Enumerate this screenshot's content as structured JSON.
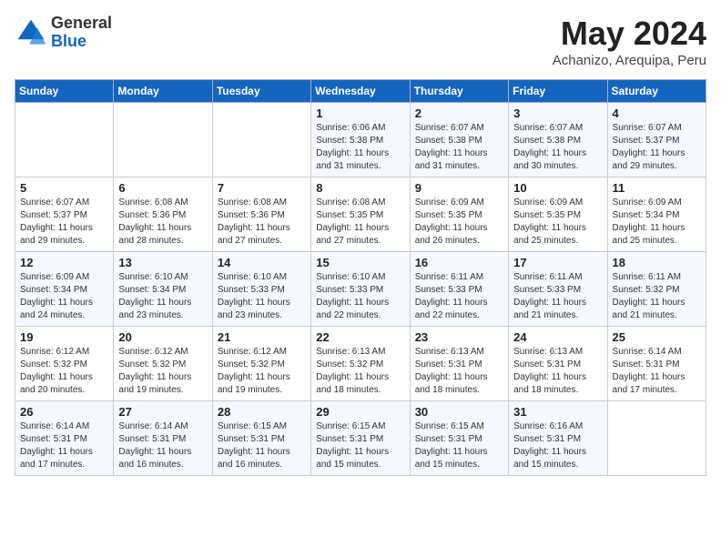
{
  "header": {
    "logo_general": "General",
    "logo_blue": "Blue",
    "title": "May 2024",
    "location": "Achanizo, Arequipa, Peru"
  },
  "days_of_week": [
    "Sunday",
    "Monday",
    "Tuesday",
    "Wednesday",
    "Thursday",
    "Friday",
    "Saturday"
  ],
  "weeks": [
    [
      {
        "day": "",
        "info": ""
      },
      {
        "day": "",
        "info": ""
      },
      {
        "day": "",
        "info": ""
      },
      {
        "day": "1",
        "info": "Sunrise: 6:06 AM\nSunset: 5:38 PM\nDaylight: 11 hours\nand 31 minutes."
      },
      {
        "day": "2",
        "info": "Sunrise: 6:07 AM\nSunset: 5:38 PM\nDaylight: 11 hours\nand 31 minutes."
      },
      {
        "day": "3",
        "info": "Sunrise: 6:07 AM\nSunset: 5:38 PM\nDaylight: 11 hours\nand 30 minutes."
      },
      {
        "day": "4",
        "info": "Sunrise: 6:07 AM\nSunset: 5:37 PM\nDaylight: 11 hours\nand 29 minutes."
      }
    ],
    [
      {
        "day": "5",
        "info": "Sunrise: 6:07 AM\nSunset: 5:37 PM\nDaylight: 11 hours\nand 29 minutes."
      },
      {
        "day": "6",
        "info": "Sunrise: 6:08 AM\nSunset: 5:36 PM\nDaylight: 11 hours\nand 28 minutes."
      },
      {
        "day": "7",
        "info": "Sunrise: 6:08 AM\nSunset: 5:36 PM\nDaylight: 11 hours\nand 27 minutes."
      },
      {
        "day": "8",
        "info": "Sunrise: 6:08 AM\nSunset: 5:35 PM\nDaylight: 11 hours\nand 27 minutes."
      },
      {
        "day": "9",
        "info": "Sunrise: 6:09 AM\nSunset: 5:35 PM\nDaylight: 11 hours\nand 26 minutes."
      },
      {
        "day": "10",
        "info": "Sunrise: 6:09 AM\nSunset: 5:35 PM\nDaylight: 11 hours\nand 25 minutes."
      },
      {
        "day": "11",
        "info": "Sunrise: 6:09 AM\nSunset: 5:34 PM\nDaylight: 11 hours\nand 25 minutes."
      }
    ],
    [
      {
        "day": "12",
        "info": "Sunrise: 6:09 AM\nSunset: 5:34 PM\nDaylight: 11 hours\nand 24 minutes."
      },
      {
        "day": "13",
        "info": "Sunrise: 6:10 AM\nSunset: 5:34 PM\nDaylight: 11 hours\nand 23 minutes."
      },
      {
        "day": "14",
        "info": "Sunrise: 6:10 AM\nSunset: 5:33 PM\nDaylight: 11 hours\nand 23 minutes."
      },
      {
        "day": "15",
        "info": "Sunrise: 6:10 AM\nSunset: 5:33 PM\nDaylight: 11 hours\nand 22 minutes."
      },
      {
        "day": "16",
        "info": "Sunrise: 6:11 AM\nSunset: 5:33 PM\nDaylight: 11 hours\nand 22 minutes."
      },
      {
        "day": "17",
        "info": "Sunrise: 6:11 AM\nSunset: 5:33 PM\nDaylight: 11 hours\nand 21 minutes."
      },
      {
        "day": "18",
        "info": "Sunrise: 6:11 AM\nSunset: 5:32 PM\nDaylight: 11 hours\nand 21 minutes."
      }
    ],
    [
      {
        "day": "19",
        "info": "Sunrise: 6:12 AM\nSunset: 5:32 PM\nDaylight: 11 hours\nand 20 minutes."
      },
      {
        "day": "20",
        "info": "Sunrise: 6:12 AM\nSunset: 5:32 PM\nDaylight: 11 hours\nand 19 minutes."
      },
      {
        "day": "21",
        "info": "Sunrise: 6:12 AM\nSunset: 5:32 PM\nDaylight: 11 hours\nand 19 minutes."
      },
      {
        "day": "22",
        "info": "Sunrise: 6:13 AM\nSunset: 5:32 PM\nDaylight: 11 hours\nand 18 minutes."
      },
      {
        "day": "23",
        "info": "Sunrise: 6:13 AM\nSunset: 5:31 PM\nDaylight: 11 hours\nand 18 minutes."
      },
      {
        "day": "24",
        "info": "Sunrise: 6:13 AM\nSunset: 5:31 PM\nDaylight: 11 hours\nand 18 minutes."
      },
      {
        "day": "25",
        "info": "Sunrise: 6:14 AM\nSunset: 5:31 PM\nDaylight: 11 hours\nand 17 minutes."
      }
    ],
    [
      {
        "day": "26",
        "info": "Sunrise: 6:14 AM\nSunset: 5:31 PM\nDaylight: 11 hours\nand 17 minutes."
      },
      {
        "day": "27",
        "info": "Sunrise: 6:14 AM\nSunset: 5:31 PM\nDaylight: 11 hours\nand 16 minutes."
      },
      {
        "day": "28",
        "info": "Sunrise: 6:15 AM\nSunset: 5:31 PM\nDaylight: 11 hours\nand 16 minutes."
      },
      {
        "day": "29",
        "info": "Sunrise: 6:15 AM\nSunset: 5:31 PM\nDaylight: 11 hours\nand 15 minutes."
      },
      {
        "day": "30",
        "info": "Sunrise: 6:15 AM\nSunset: 5:31 PM\nDaylight: 11 hours\nand 15 minutes."
      },
      {
        "day": "31",
        "info": "Sunrise: 6:16 AM\nSunset: 5:31 PM\nDaylight: 11 hours\nand 15 minutes."
      },
      {
        "day": "",
        "info": ""
      }
    ]
  ]
}
